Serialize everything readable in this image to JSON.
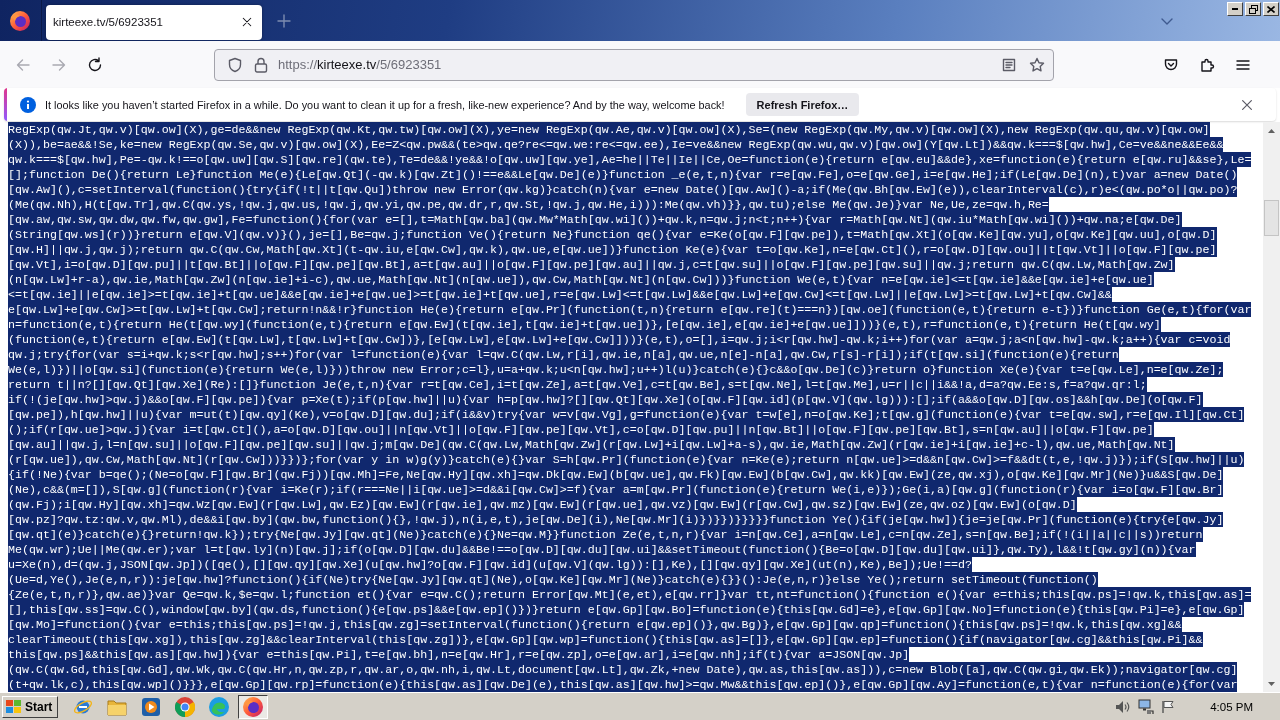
{
  "tab_strip": {
    "tabs": [
      {
        "title": "kirteexe.tv/5/6923351",
        "selected": true
      }
    ]
  },
  "nav_bar": {
    "buttons": [
      {
        "kind": "back",
        "disabled": true
      },
      {
        "kind": "forward",
        "disabled": true
      },
      {
        "kind": "reload",
        "disabled": false
      }
    ],
    "address": {
      "scheme": "https://",
      "host": "kirteexe.tv",
      "path": "/5/6923351"
    }
  },
  "notification": {
    "message": "It looks like you haven’t started Firefox in a while. Do you want to clean it up for a fresh, like-new experience? And by the way, welcome back!",
    "button": "Refresh Firefox…"
  },
  "document": {
    "selected": true,
    "lines": [
      "RegExp(qw.Jt,qw.v)[qw.ow](X),ge=de&&new RegExp(qw.Kt,qw.tw)[qw.ow](X),ye=new RegExp(qw.Ae,qw.v)[qw.ow](X),Se=(new RegExp(qw.My,qw.v)[qw.ow](X),new RegExp(qw.qu,qw.v)[qw.ow]",
      "(X)),be=ae&&!Se,ke=new RegExp(qw.Se,qw.v)[qw.ow](X),Ee=Z<qw.pw&&(te>qw.qe?re<=qw.we:re<=qw.ee),Ie=ve&&new RegExp(qw.wu,qw.v)[qw.ow](Y[qw.Lt])&&qw.k===$[qw.hw],Ce=ve&&ne&&Ee&&",
      "qw.k===$[qw.hw],Pe=-qw.k!==o[qw.uw][qw.S][qw.re](qw.te),Te=de&&!ye&&!o[qw.uw][qw.ye],Ae=he||Te||Ie||Ce,Oe=function(e){return e[qw.eu]&&de},xe=function(e){return e[qw.ru]&&se},Le=",
      "[];function De(){return Le}function Me(e){Le[qw.Qt](-qw.k)[qw.Zt]()!==e&&Le[qw.De](e)}function _e(e,t,n){var r=e[qw.Fe],o=e[qw.Ge],i=e[qw.He];if(Le[qw.De](n),t)var a=new Date()",
      "[qw.Aw](),c=setInterval(function(){try{if(!t||t[qw.Qu])throw new Error(qw.kg)}catch(n){var e=new Date()[qw.Aw]()-a;if(Me(qw.Bh[qw.Ew](e)),clearInterval(c),r)e<(qw.po*o||qw.po)?",
      "(Me(qw.Nh),H(t[qw.Tr],qw.C(qw.ys,!qw.j,qw.us,!qw.j,qw.yi,qw.pe,qw.dr,r,qw.St,!qw.j,qw.He,i))):Me(qw.vh)}},qw.tu);else Me(qw.Je)}var Ne,Ue,ze=qw.h,Re=",
      "[qw.aw,qw.sw,qw.dw,qw.fw,qw.gw],Fe=function(){for(var e=[],t=Math[qw.ba](qw.Mw*Math[qw.wi]())+qw.k,n=qw.j;n<t;n++){var r=Math[qw.Nt](qw.iu*Math[qw.wi]())+qw.na;e[qw.De]",
      "(String[qw.ws](r))}return e[qw.V](qw.v)}(),je=[],Be=qw.j;function Ve(){return Ne}function qe(){var e=Ke(o[qw.F][qw.pe]),t=Math[qw.Xt](o[qw.Ke][qw.yu],o[qw.Ke][qw.uu],o[qw.D]",
      "[qw.H]||qw.j,qw.j);return qw.C(qw.Cw,Math[qw.Xt](t-qw.iu,e[qw.Cw],qw.k),qw.ue,e[qw.ue])}function Ke(e){var t=o[qw.Ke],n=e[qw.Ct](),r=o[qw.D][qw.ou]||t[qw.Vt]||o[qw.F][qw.pe]",
      "[qw.Vt],i=o[qw.D][qw.pu]||t[qw.Bt]||o[qw.F][qw.pe][qw.Bt],a=t[qw.au]||o[qw.F][qw.pe][qw.au]||qw.j,c=t[qw.su]||o[qw.F][qw.pe][qw.su]||qw.j;return qw.C(qw.Lw,Math[qw.Zw]",
      "(n[qw.Lw]+r-a),qw.ie,Math[qw.Zw](n[qw.ie]+i-c),qw.ue,Math[qw.Nt](n[qw.ue]),qw.Cw,Math[qw.Nt](n[qw.Cw]))}function We(e,t){var n=e[qw.ie]<=t[qw.ie]&&e[qw.ie]+e[qw.ue]",
      "<=t[qw.ie]||e[qw.ie]>=t[qw.ie]+t[qw.ue]&&e[qw.ie]+e[qw.ue]>=t[qw.ie]+t[qw.ue],r=e[qw.Lw]<=t[qw.Lw]&&e[qw.Lw]+e[qw.Cw]<=t[qw.Lw]||e[qw.Lw]>=t[qw.Lw]+t[qw.Cw]&&",
      "e[qw.Lw]+e[qw.Cw]>=t[qw.Lw]+t[qw.Cw];return!n&&!r}function He(e){return e[qw.Pr](function(t,n){return e[qw.re](t)===n})[qw.oe](function(e,t){return e-t})}function Ge(e,t){for(var",
      "n=function(e,t){return He(t[qw.wy](function(e,t){return e[qw.Ew](t[qw.ie],t[qw.ie]+t[qw.ue])},[e[qw.ie],e[qw.ie]+e[qw.ue]]))}(e,t),r=function(e,t){return He(t[qw.wy]",
      "(function(e,t){return e[qw.Ew](t[qw.Lw],t[qw.Lw]+t[qw.Cw])},[e[qw.Lw],e[qw.Lw]+e[qw.Cw]]))}(e,t),o=[],i=qw.j;i<r[qw.hw]-qw.k;i++)for(var a=qw.j;a<n[qw.hw]-qw.k;a++){var c=void",
      "qw.j;try{for(var s=i+qw.k;s<r[qw.hw];s++)for(var l=function(e){var l=qw.C(qw.Lw,r[i],qw.ie,n[a],qw.ue,n[e]-n[a],qw.Cw,r[s]-r[i]);if(t[qw.si](function(e){return",
      "We(e,l)})||o[qw.si](function(e){return We(e,l)}))throw new Error;c=l},u=a+qw.k;u<n[qw.hw];u++)l(u)}catch(e){}c&&o[qw.De](c)}return o}function Xe(e){var t=e[qw.Le],n=e[qw.Ze];",
      "return t||n?[][qw.Qt][qw.Xe](Re):[]}function Je(e,t,n){var r=t[qw.Ce],i=t[qw.Ze],a=t[qw.Ve],c=t[qw.Be],s=t[qw.Ne],l=t[qw.Me],u=r||c||i&&!a,d=a?qw.Ee:s,f=a?qw.qr:l;",
      "if(!(je[qw.hw]>qw.j)&&o[qw.F][qw.pe]){var p=Xe(t);if(p[qw.hw]||u){var h=p[qw.hw]?[][qw.Qt][qw.Xe](o[qw.F][qw.id](p[qw.V](qw.lg))):[];if(a&&o[qw.D][qw.os]&&h[qw.De](o[qw.F]",
      "[qw.pe]),h[qw.hw]||u){var m=ut(t)[qw.qy](Ke),v=o[qw.D][qw.du];if(i&&v)try{var w=v[qw.Vg],g=function(e){var t=w[e],n=o[qw.Ke];t[qw.g](function(e){var t=e[qw.sw],r=e[qw.Il][qw.Ct]",
      "();if(r[qw.ue]>qw.j){var i=t[qw.Ct](),a=o[qw.D][qw.ou]||n[qw.Vt]||o[qw.F][qw.pe][qw.Vt],c=o[qw.D][qw.pu]||n[qw.Bt]||o[qw.F][qw.pe][qw.Bt],s=n[qw.au]||o[qw.F][qw.pe]",
      "[qw.au]||qw.j,l=n[qw.su]||o[qw.F][qw.pe][qw.su]||qw.j;m[qw.De](qw.C(qw.Lw,Math[qw.Zw](r[qw.Lw]+i[qw.Lw]+a-s),qw.ie,Math[qw.Zw](r[qw.ie]+i[qw.ie]+c-l),qw.ue,Math[qw.Nt]",
      "(r[qw.ue]),qw.Cw,Math[qw.Nt](r[qw.Cw]))}})};for(var y in w)g(y)}catch(e){}var S=h[qw.Pr](function(e){var n=Ke(e);return n[qw.ue]>=d&&n[qw.Cw]>=f&&dt(t,e,!qw.j)});if(S[qw.hw]||u)",
      "{if(!Ne){var b=qe();(Ne=o[qw.F][qw.Br](qw.Fj))[qw.Mh]=Fe,Ne[qw.Hy][qw.xh]=qw.Dk[qw.Ew](b[qw.ue],qw.Fk)[qw.Ew](b[qw.Cw],qw.kk)[qw.Ew](ze,qw.xj),o[qw.Ke][qw.Mr](Ne)}u&&S[qw.De]",
      "(Ne),c&&(m=[]),S[qw.g](function(r){var i=Ke(r);if(r===Ne||i[qw.ue]>=d&&i[qw.Cw]>=f){var a=m[qw.Pr](function(e){return We(i,e)});Ge(i,a)[qw.g](function(r){var i=o[qw.F][qw.Br]",
      "(qw.Fj);i[qw.Hy][qw.xh]=qw.Wz[qw.Ew](r[qw.Lw],qw.Ez)[qw.Ew](r[qw.ie],qw.mz)[qw.Ew](r[qw.ue],qw.vz)[qw.Ew](r[qw.Cw],qw.sz)[qw.Ew](ze,qw.oz)[qw.Ew](o[qw.D]",
      "[qw.pz]?qw.tz:qw.v,qw.Ml),de&&i[qw.by](qw.bw,function(){},!qw.j),n(i,e,t),je[qw.De](i),Ne[qw.Mr](i)})}})}}}}}function Ye(){if(je[qw.hw]){je=je[qw.Pr](function(e){try{e[qw.Jy]",
      "[qw.qt](e)}catch(e){}return!qw.k});try{Ne[qw.Jy][qw.qt](Ne)}catch(e){}Ne=qw.M}}function Ze(e,t,n,r){var i=n[qw.Ce],a=n[qw.Le],c=n[qw.Ze],s=n[qw.Be];if(!(i||a||c||s))return",
      "Me(qw.wr);Ue||Me(qw.er);var l=t[qw.ly](n)[qw.j];if(o[qw.D][qw.du]&&Be!==o[qw.D][qw.du][qw.ui]&&setTimeout(function(){Be=o[qw.D][qw.du][qw.ui]},qw.Ty),l&&!t[qw.gy](n)){var",
      "u=Xe(n),d=(qw.j,JSON[qw.Jp])([qe(),[][qw.qy][qw.Xe](u[qw.hw]?o[qw.F][qw.id](u[qw.V](qw.lg)):[],Ke),[][qw.qy][qw.Xe](ut(n),Ke),Be]);Ue!==d?",
      "(Ue=d,Ye(),Je(e,n,r)):je[qw.hw]?function(){if(Ne)try{Ne[qw.Jy][qw.qt](Ne),o[qw.Ke][qw.Mr](Ne)}catch(e){}}():Je(e,n,r)}else Ye();return setTimeout(function()",
      "{Ze(e,t,n,r)},qw.ae)}var Qe=qw.k,$e=qw.l;function et(){var e=qw.C();return Error[qw.Mt](e,et),e[qw.rr]}var tt,nt=function(){function e(){var e=this;this[qw.ps]=!qw.k,this[qw.as]=",
      "[],this[qw.ss]=qw.C(),window[qw.by](qw.ds,function(){e[qw.ps]&&e[qw.ep]()})}return e[qw.Gp][qw.Bo]=function(e){this[qw.Gd]=e},e[qw.Gp][qw.No]=function(e){this[qw.Pi]=e},e[qw.Gp]",
      "[qw.Mo]=function(){var e=this;this[qw.ps]=!qw.j,this[qw.zg]=setInterval(function(){return e[qw.ep]()},qw.Bg)},e[qw.Gp][qw.qp]=function(){this[qw.ps]=!qw.k,this[qw.xg]&&",
      "clearTimeout(this[qw.xg]),this[qw.zg]&&clearInterval(this[qw.zg])},e[qw.Gp][qw.wp]=function(){this[qw.as]=[]},e[qw.Gp][qw.ep]=function(){if(navigator[qw.cg]&&this[qw.Pi]&&",
      "this[qw.ps]&&this[qw.as][qw.hw]){var e=this[qw.Pi],t=e[qw.bh],n=e[qw.Hr],r=e[qw.zp],o=e[qw.ar],i=e[qw.nh];if(t){var a=JSON[qw.Jp]",
      "(qw.C(qw.Gd,this[qw.Gd],qw.Wk,qw.C(qw.Hr,n,qw.zp,r,qw.ar,o,qw.nh,i,qw.Lt,document[qw.Lt],qw.Zk,+new Date),qw.as,this[qw.as])),c=new Blob([a],qw.C(qw.gi,qw.Ek));navigator[qw.cg]",
      "(t+qw.lk,c),this[qw.wp]()}}},e[qw.Gp][qw.rp]=function(e){this[qw.as][qw.De](e),this[qw.as][qw.hw]>=qw.Mw&&this[qw.ep]()},e[qw.Gp][qw.Ay]=function(e,t){var n=function(e){for(var"
    ]
  },
  "taskbar": {
    "start": "Start",
    "apps": [
      {
        "kind": "ie",
        "selected": false
      },
      {
        "kind": "folder",
        "selected": false
      },
      {
        "kind": "media",
        "selected": false
      },
      {
        "kind": "chrome",
        "selected": false
      },
      {
        "kind": "edge",
        "selected": false
      },
      {
        "kind": "firefox",
        "selected": true
      }
    ],
    "clock": "4:05 PM"
  }
}
